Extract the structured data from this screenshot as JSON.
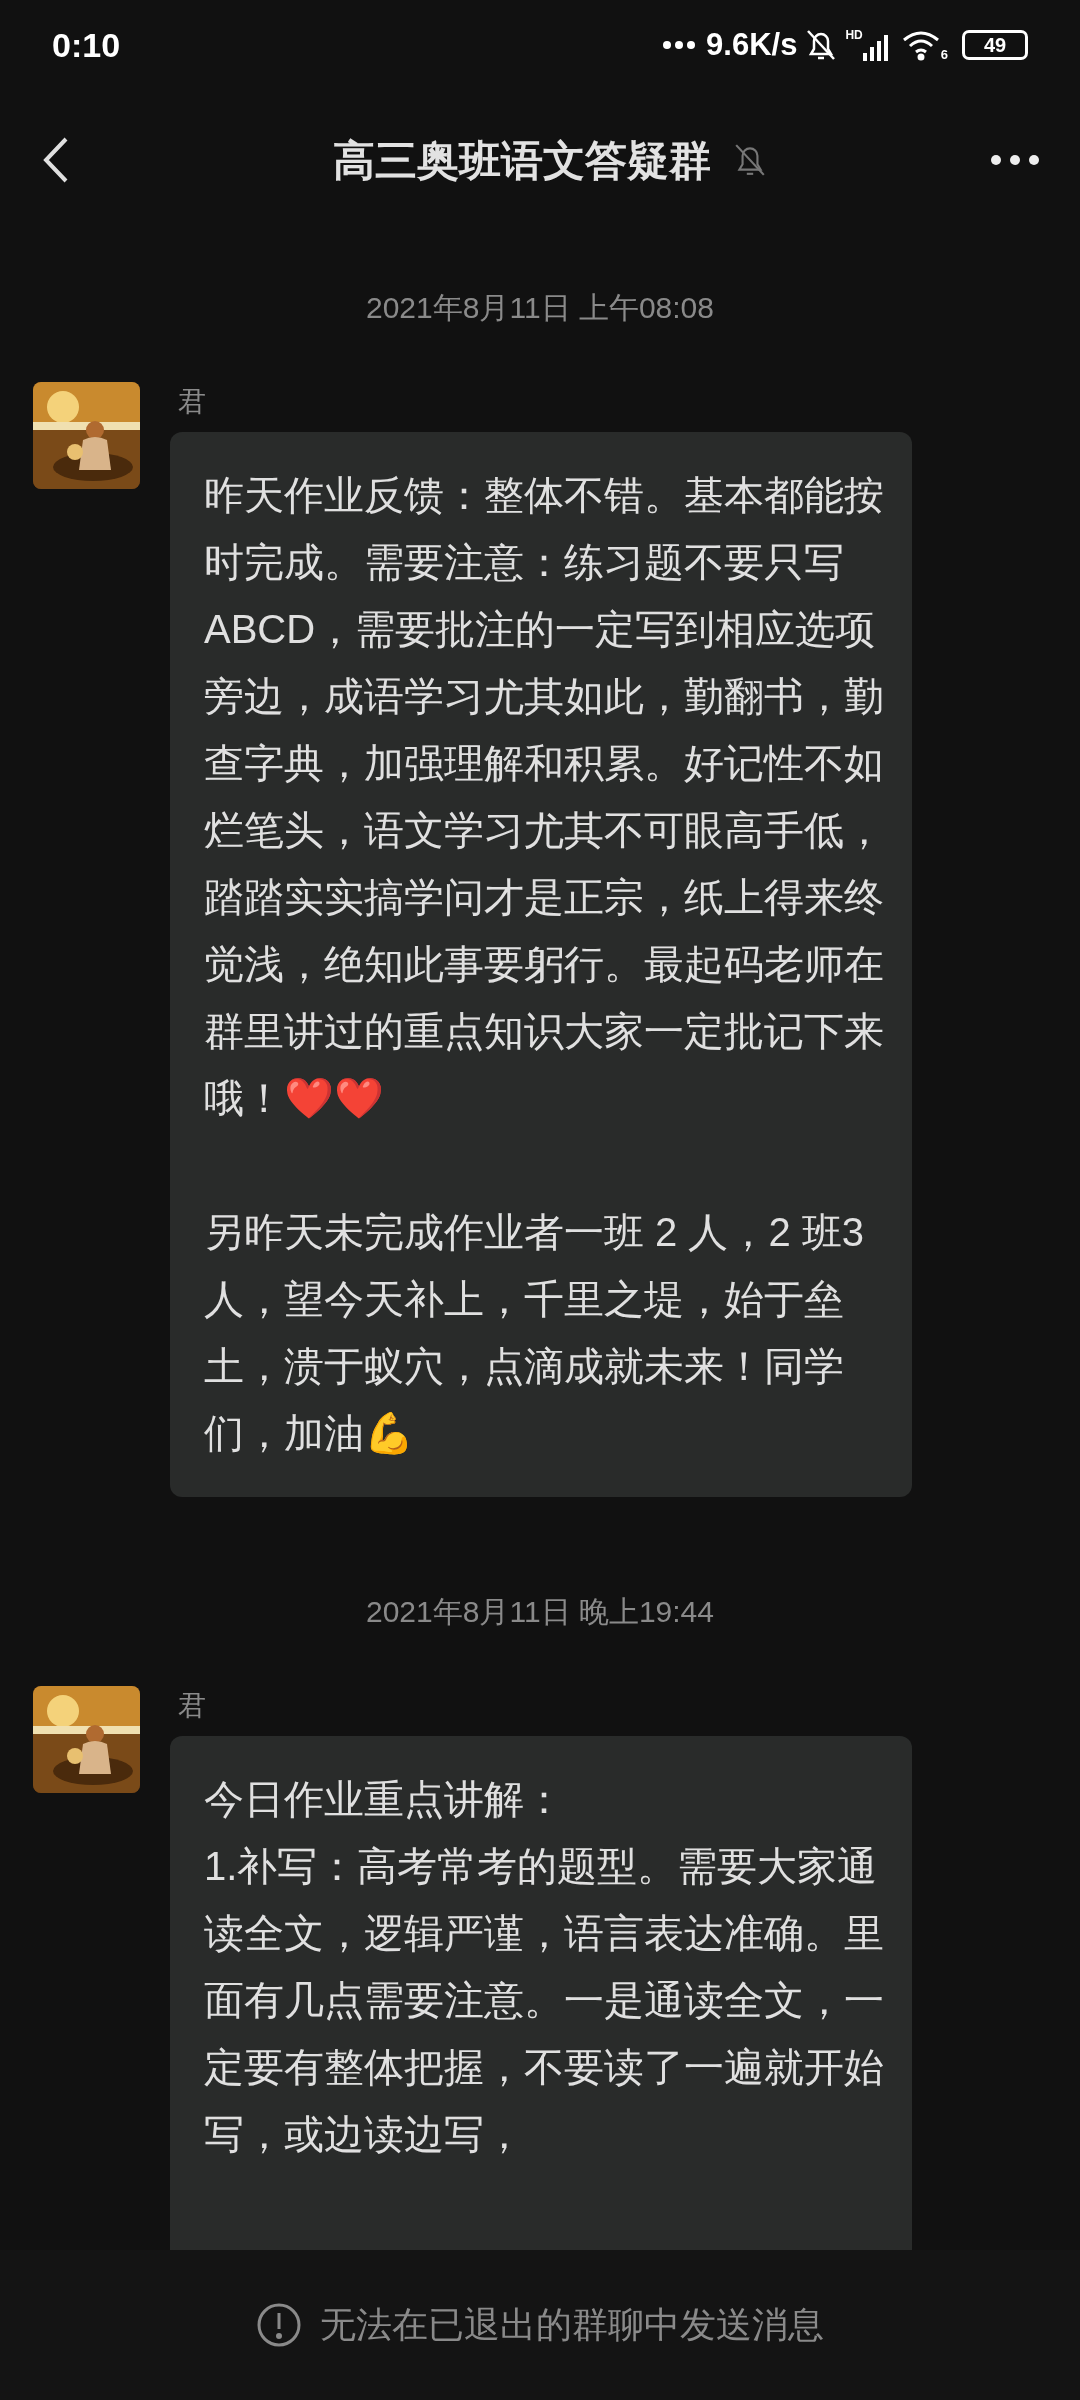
{
  "status_bar": {
    "time": "0:10",
    "speed": "9.6K/s",
    "signal_label": "HD",
    "wifi_label": "6",
    "battery": "49"
  },
  "header": {
    "title": "高三奥班语文答疑群"
  },
  "messages": [
    {
      "time": "2021年8月11日 上午08:08",
      "sender": "君",
      "paragraphs": [
        "昨天作业反馈：整体不错。基本都能按时完成。需要注意：练习题不要只写 ABCD，需要批注的一定写到相应选项旁边，成语学习尤其如此，勤翻书，勤查字典，加强理解和积累。好记性不如烂笔头，语文学习尤其不可眼高手低，踏踏实实搞学问才是正宗，纸上得来终觉浅，绝知此事要躬行。最起码老师在群里讲过的重点知识大家一定批记下来哦！❤️❤️",
        "另昨天未完成作业者一班 2 人，2 班3 人，望今天补上，千里之堤，始于垒土，溃于蚁穴，点滴成就未来！同学们，加油💪"
      ]
    },
    {
      "time": "2021年8月11日 晚上19:44",
      "sender": "君",
      "paragraphs": [
        "今日作业重点讲解：",
        "1.补写：高考常考的题型。需要大家通读全文，逻辑严谨，语言表达准确。里面有几点需要注意。一是通读全文，一定要有整体把握，不要读了一遍就开始写，或边读边写，"
      ]
    }
  ],
  "notice": "无法在已退出的群聊中发送消息"
}
